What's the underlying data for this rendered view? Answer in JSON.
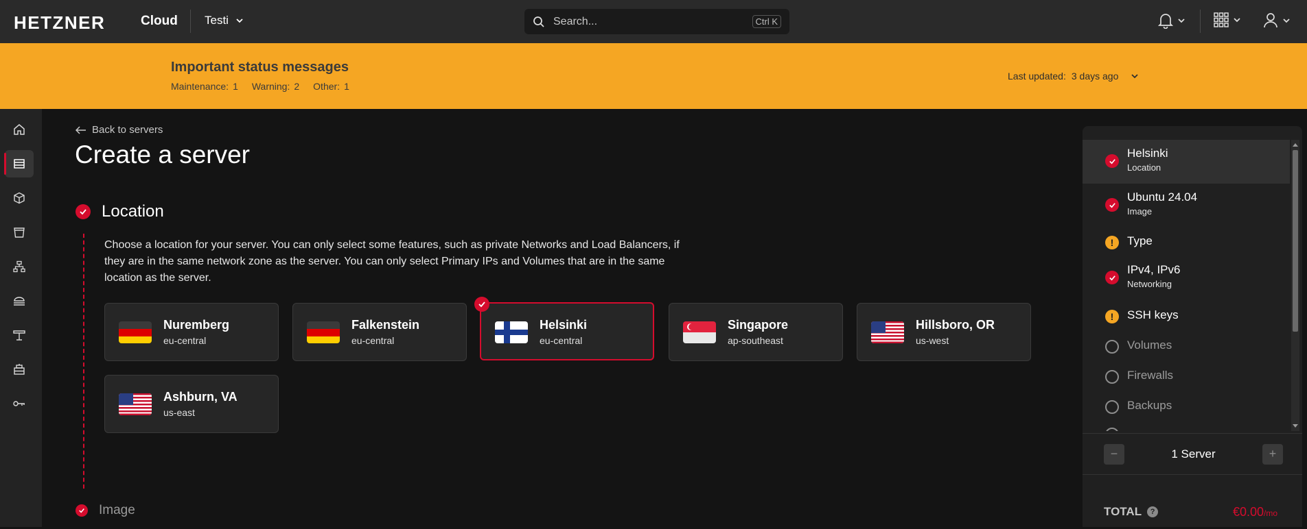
{
  "header": {
    "logo": "HETZNER",
    "product": "Cloud",
    "project": "Testi",
    "search_placeholder": "Search...",
    "search_shortcut": "Ctrl K"
  },
  "banner": {
    "title": "Important status messages",
    "maintenance_label": "Maintenance:",
    "maintenance_count": "1",
    "warning_label": "Warning:",
    "warning_count": "2",
    "other_label": "Other:",
    "other_count": "1",
    "updated_label": "Last updated:",
    "updated_value": "3 days ago"
  },
  "sidebar": [
    "home-icon",
    "servers-icon",
    "cube-icon",
    "bucket-icon",
    "network-icon",
    "load-balancer-icon",
    "firewall-icon",
    "robot-icon",
    "key-icon"
  ],
  "main": {
    "back_label": "Back to servers",
    "title": "Create a server",
    "location_heading": "Location",
    "location_desc": "Choose a location for your server. You can only select some features, such as private Networks and Load Balancers, if they are in the same network zone as the server. You can only select Primary IPs and Volumes that are in the same location as the server.",
    "image_heading": "Image",
    "locations": [
      {
        "name": "Nuremberg",
        "zone": "eu-central",
        "flag": "de"
      },
      {
        "name": "Falkenstein",
        "zone": "eu-central",
        "flag": "de"
      },
      {
        "name": "Helsinki",
        "zone": "eu-central",
        "flag": "fi"
      },
      {
        "name": "Singapore",
        "zone": "ap-southeast",
        "flag": "sg"
      },
      {
        "name": "Hillsboro, OR",
        "zone": "us-west",
        "flag": "us"
      },
      {
        "name": "Ashburn, VA",
        "zone": "us-east",
        "flag": "us"
      }
    ]
  },
  "summary": {
    "steps": [
      {
        "title": "Helsinki",
        "sub": "Location",
        "status": "done"
      },
      {
        "title": "Ubuntu 24.04",
        "sub": "Image",
        "status": "done"
      },
      {
        "title": "Type",
        "sub": "",
        "status": "warn"
      },
      {
        "title": "IPv4, IPv6",
        "sub": "Networking",
        "status": "done"
      },
      {
        "title": "SSH keys",
        "sub": "",
        "status": "warn"
      },
      {
        "title": "Volumes",
        "sub": "",
        "status": "empty"
      },
      {
        "title": "Firewalls",
        "sub": "",
        "status": "empty"
      },
      {
        "title": "Backups",
        "sub": "",
        "status": "empty"
      }
    ],
    "quantity_label": "1 Server",
    "total_label": "TOTAL",
    "total_value": "€0.00",
    "total_unit": "/mo"
  },
  "colors": {
    "accent": "#d50c2d",
    "banner": "#f5a623",
    "topbar": "#2a2a2a",
    "background": "#141414"
  }
}
